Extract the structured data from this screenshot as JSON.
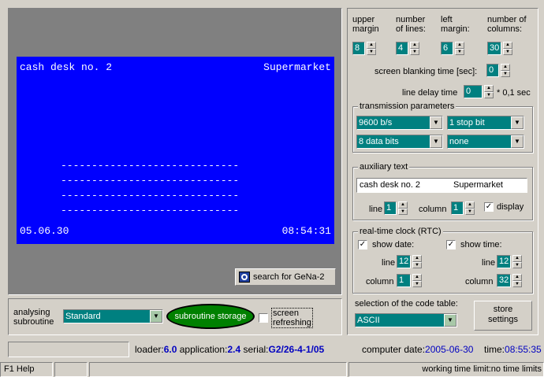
{
  "display": {
    "top_left": "cash desk no. 2",
    "top_right": "Supermarket",
    "dashes": [
      "-----------------------------",
      "-----------------------------",
      "-----------------------------",
      "-----------------------------"
    ],
    "bottom_left": "05.06.30",
    "bottom_right": "08:54:31"
  },
  "search_button": "search for GeNa-2",
  "params": {
    "upper_margin": {
      "label1": "upper",
      "label2": "margin",
      "value": "8"
    },
    "number_of_lines": {
      "label1": "number",
      "label2": "of lines:",
      "value": "4"
    },
    "left_margin": {
      "label1": "left",
      "label2": "margin:",
      "value": "6"
    },
    "number_of_columns": {
      "label1": "number of",
      "label2": "columns:",
      "value": "30"
    },
    "blanking_label": "screen blanking time [sec]:",
    "blanking_value": "0",
    "line_delay_label": "line delay time",
    "line_delay_value": "0",
    "line_delay_unit": "* 0,1 sec"
  },
  "transmission": {
    "caption": "transmission parameters",
    "baud": "9600 b/s",
    "stop": "1 stop bit",
    "data": "8 data bits",
    "parity": "none"
  },
  "aux": {
    "caption": "auxiliary text",
    "text_left": "cash desk no. 2",
    "text_right": "Supermarket",
    "line_label": "line",
    "line_value": "1",
    "column_label": "column",
    "column_value": "1",
    "display_label": "display"
  },
  "rtc": {
    "caption": "real-time clock (RTC)",
    "show_date": "show date:",
    "show_time": "show time:",
    "line_label": "line",
    "date_line": "12",
    "time_line": "12",
    "column_label": "column",
    "date_column": "1",
    "time_column": "32"
  },
  "bottom": {
    "analysing1": "analysing",
    "analysing2": "subroutine",
    "standard": "Standard",
    "storage": "subroutine storage",
    "refresh1": "screen",
    "refresh2": "refreshing",
    "code_table_label": "selection of the code table:",
    "code_table_value": "ASCII",
    "store1": "store",
    "store2": "settings"
  },
  "info": {
    "loader_label": "loader:",
    "loader": "6.0",
    "app_label": "application:",
    "app": "2.4",
    "serial_label": "serial:",
    "serial": "G2/26-4-1/05",
    "date_label": "computer date:",
    "date": "2005-06-30",
    "time_label": "time:",
    "time": "08:55:35"
  },
  "status": {
    "help": "F1 Help",
    "limit": "working time limit:no time limits"
  }
}
